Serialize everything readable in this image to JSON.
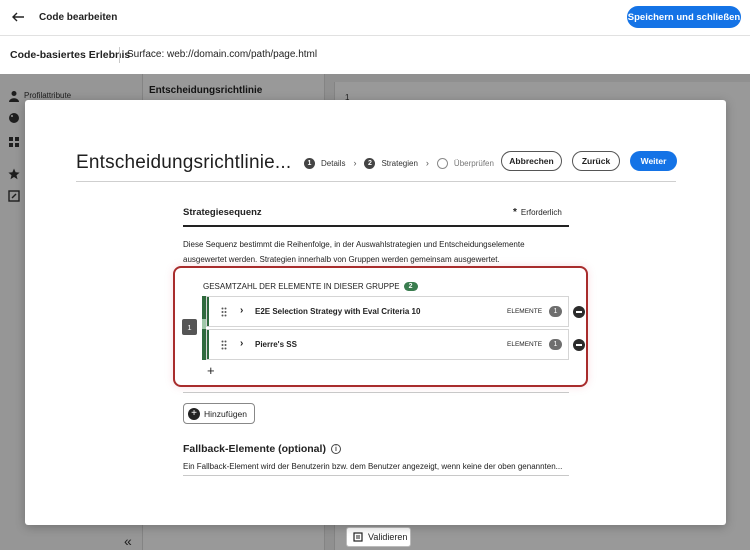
{
  "header": {
    "title": "Code bearbeiten",
    "save_button": "Speichern und schließen",
    "experience_title": "Code-basiertes Erlebnis",
    "surface": "Surface: web://domain.com/path/page.html"
  },
  "background": {
    "sidebar_label": "Profilattribute",
    "panel_title": "Entscheidungsrichtlinie",
    "line_number": "1",
    "validate_button": "Validieren",
    "collapse_glyph": "«"
  },
  "modal": {
    "title": "Entscheidungsrichtlinie...",
    "steps": [
      {
        "number": "1",
        "label": "Details"
      },
      {
        "number": "2",
        "label": "Strategien"
      },
      {
        "number": "",
        "label": "Überprüfen"
      }
    ],
    "cancel_button": "Abbrechen",
    "back_button": "Zurück",
    "next_button": "Weiter",
    "section_title": "Strategiesequenz",
    "required_label": "Erforderlich",
    "description": "Diese Sequenz bestimmt die Reihenfolge, in der Auswahlstrategien und Entscheidungselemente ausgewertet werden. Strategien innerhalb von Gruppen werden gemeinsam ausgewertet.",
    "group": {
      "header": "GESAMTZAHL DER ELEMENTE IN DIESER GRUPPE",
      "count": "2",
      "index": "1",
      "strategies": [
        {
          "name": "E2E Selection Strategy with Eval Criteria 10",
          "items_label": "ELEMENTE",
          "items_count": "1"
        },
        {
          "name": "Pierre's SS",
          "items_label": "ELEMENTE",
          "items_count": "1"
        }
      ]
    },
    "add_button": "Hinzufügen",
    "fallback_title": "Fallback-Elemente (optional)",
    "fallback_description": "Ein Fallback-Element wird der Benutzerin bzw. dem Benutzer angezeigt, wenn keine der oben genannten..."
  },
  "colors": {
    "accent_blue": "#1473e6",
    "group_green": "#2f6a3d",
    "highlight_red": "#a82c2c"
  }
}
